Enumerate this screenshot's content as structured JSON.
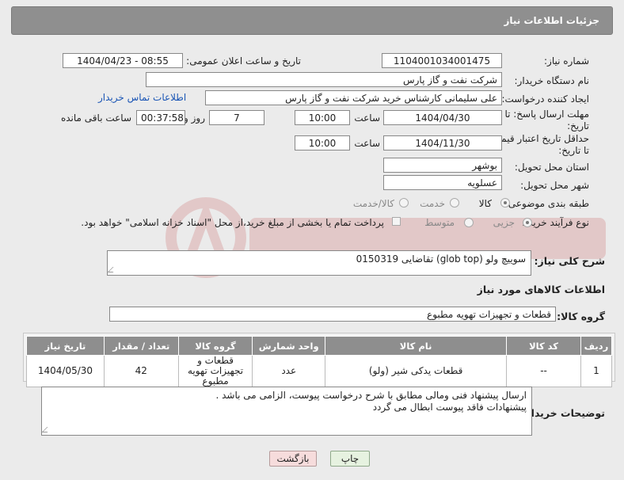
{
  "header": {
    "title": "جزئیات اطلاعات نیاز"
  },
  "fields": {
    "need_number_label": "شماره نیاز:",
    "need_number": "1104001034001475",
    "announce_label": "تاریخ و ساعت اعلان عمومی:",
    "announce_value": "1404/04/23 - 08:55",
    "buyer_org_label": "نام دستگاه خریدار:",
    "buyer_org": "شرکت نفت و گاز پارس",
    "requester_label": "ایجاد کننده درخواست:",
    "requester": "علی سلیمانی کارشناس خرید شرکت نفت و گاز پارس",
    "buyer_contact_link": "اطلاعات تماس خریدار",
    "deadline_label_1": "مهلت ارسال پاسخ: تا",
    "deadline_label_2": "تاریخ:",
    "deadline_date": "1404/04/30",
    "time_label": "ساعت",
    "deadline_time": "10:00",
    "days_value": "7",
    "days_label": "روز و",
    "remaining_time": "00:37:58",
    "remaining_label": "ساعت باقی مانده",
    "min_validity_label_1": "حداقل تاریخ اعتبار قیمت:",
    "min_validity_label_2": "تا تاریخ:",
    "validity_date": "1404/11/30",
    "validity_time": "10:00",
    "province_label": "استان محل تحویل:",
    "province": "بوشهر",
    "city_label": "شهر محل تحویل:",
    "city": "عسلویه",
    "category_label": "طبقه بندی موضوعی:",
    "category_options": [
      "کالا",
      "خدمت",
      "کالا/خدمت"
    ],
    "process_label": "نوع فرآیند خرید :",
    "process_options": [
      "جزیی",
      "متوسط"
    ],
    "payment_note": "پرداخت تمام یا بخشی از مبلغ خرید،از محل \"اسناد خزانه اسلامی\" خواهد بود.",
    "description_label": "شرح کلی نیاز:",
    "description": "سوییچ ولو (glob top) تقاضایی 0150319",
    "goods_info_title": "اطلاعات کالاهای مورد نیاز",
    "goods_group_label": "گروه کالا:",
    "goods_group": "قطعات و تجهیزات تهویه مطبوع"
  },
  "table": {
    "headers": [
      "ردیف",
      "کد کالا",
      "نام کالا",
      "واحد شمارش",
      "گروه کالا",
      "تعداد / مقدار",
      "تاریخ نیاز"
    ],
    "rows": [
      [
        "1",
        "--",
        "قطعات یدکی شیر (ولو)",
        "عدد",
        "قطعات و تجهیزات تهویه مطبوع",
        "42",
        "1404/05/30"
      ]
    ]
  },
  "buyer_notes": {
    "label": "توضیحات خریدار:",
    "line1": "ارسال پیشنهاد فنی ومالی مطابق با شرح درخواست پیوست، الزامی می باشد .",
    "line2": "پیشنهادات فاقد پیوست ابطال می گردد"
  },
  "buttons": {
    "print": "چاپ",
    "back": "بازگشت"
  }
}
